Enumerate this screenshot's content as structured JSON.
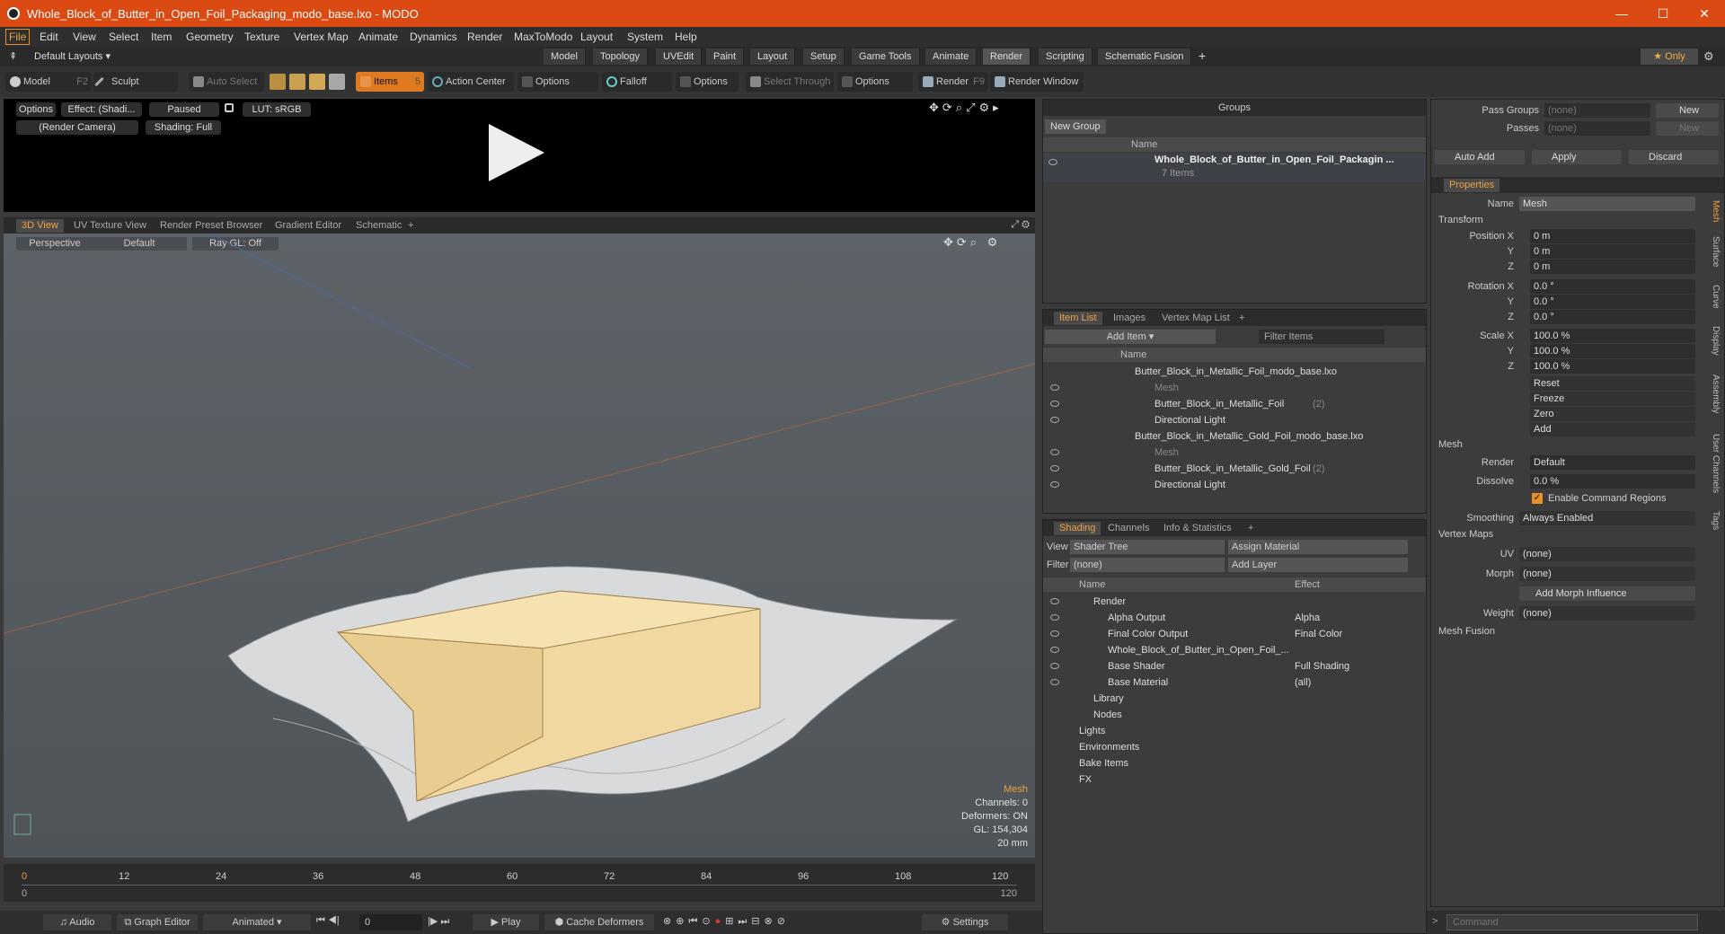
{
  "window": {
    "title": "Whole_Block_of_Butter_in_Open_Foil_Packaging_modo_base.lxo - MODO",
    "minimize": "—",
    "maximize": "☐",
    "close": "✕"
  },
  "menu": [
    "File",
    "Edit",
    "View",
    "Select",
    "Item",
    "Geometry",
    "Texture",
    "Vertex Map",
    "Animate",
    "Dynamics",
    "Render",
    "MaxToModo",
    "Layout",
    "System",
    "Help"
  ],
  "layouts": {
    "label": "Default Layouts ▾",
    "tabs": [
      "Model",
      "Topology",
      "UVEdit",
      "Paint",
      "Layout",
      "Setup",
      "Game Tools",
      "Animate",
      "Render",
      "Scripting",
      "Schematic Fusion"
    ],
    "active": "Render",
    "plus": "+",
    "only": "★  Only"
  },
  "toolbar": {
    "model": "Model",
    "model_key": "F2",
    "sculpt": "Sculpt",
    "auto_select": "Auto Select",
    "items": "Items",
    "items_key": "5",
    "action_center": "Action Center",
    "options1": "Options",
    "falloff": "Falloff",
    "options2": "Options",
    "select_through": "Select Through",
    "options3": "Options",
    "render": "Render",
    "render_key": "F9",
    "render_window": "Render Window"
  },
  "preview": {
    "options": "Options",
    "effect": "Effect: (Shadi...",
    "paused": "Paused",
    "lut": "LUT: sRGB",
    "camera": "(Render Camera)",
    "shading": "Shading: Full"
  },
  "viewport_tabs": [
    "3D View",
    "UV Texture View",
    "Render Preset Browser",
    "Gradient Editor",
    "Schematic",
    "+"
  ],
  "viewport": {
    "perspective": "Perspective",
    "default": "Default",
    "raygl": "Ray GL: Off",
    "stats": {
      "item": "Mesh",
      "channels": "Channels: 0",
      "deformers": "Deformers: ON",
      "gl": "GL: 154,304",
      "size": "20 mm"
    }
  },
  "timeline": {
    "ticks": [
      "0",
      "12",
      "24",
      "36",
      "48",
      "60",
      "72",
      "84",
      "96",
      "108",
      "120"
    ],
    "start": "0",
    "end": "120"
  },
  "bottombar": {
    "audio": "Audio",
    "graph_editor": "Graph Editor",
    "animated": "Animated",
    "frame": "0",
    "play": "Play",
    "cache": "Cache Deformers",
    "settings": "Settings",
    "command_placeholder": "Command"
  },
  "groups": {
    "title": "Groups",
    "new_group": "New Group",
    "col_name": "Name",
    "item": "Whole_Block_of_Butter_in_Open_Foil_Packagin ...",
    "count": "7 Items"
  },
  "item_list": {
    "tabs": [
      "Item List",
      "Images",
      "Vertex Map List",
      "+"
    ],
    "add_item": "Add Item",
    "filter": "Filter Items",
    "col_name": "Name",
    "rows": [
      {
        "label": "Butter_Block_in_Metallic_Foil_modo_base.lxo",
        "indent": 0,
        "dim": false,
        "eye": false
      },
      {
        "label": "Mesh",
        "indent": 1,
        "dim": true,
        "eye": true
      },
      {
        "label": "Butter_Block_in_Metallic_Foil",
        "suffix": "(2)",
        "indent": 1,
        "dim": false,
        "eye": true
      },
      {
        "label": "Directional Light",
        "indent": 1,
        "dim": false,
        "eye": true
      },
      {
        "label": "Butter_Block_in_Metallic_Gold_Foil_modo_base.lxo",
        "indent": 0,
        "dim": false,
        "eye": false
      },
      {
        "label": "Mesh",
        "indent": 1,
        "dim": true,
        "eye": true
      },
      {
        "label": "Butter_Block_in_Metallic_Gold_Foil",
        "suffix": "(2)",
        "indent": 1,
        "dim": false,
        "eye": true
      },
      {
        "label": "Directional Light",
        "indent": 1,
        "dim": false,
        "eye": true
      }
    ]
  },
  "shading": {
    "tabs": [
      "Shading",
      "Channels",
      "Info & Statistics",
      "+"
    ],
    "view_label": "View",
    "view": "Shader Tree",
    "assign": "Assign Material",
    "filter_label": "Filter",
    "filter": "(none)",
    "add_layer": "Add Layer",
    "col_name": "Name",
    "col_effect": "Effect",
    "rows": [
      {
        "name": "Render",
        "effect": "",
        "indent": 1
      },
      {
        "name": "Alpha Output",
        "effect": "Alpha",
        "indent": 2
      },
      {
        "name": "Final Color Output",
        "effect": "Final Color",
        "indent": 2
      },
      {
        "name": "Whole_Block_of_Butter_in_Open_Foil_...",
        "effect": "",
        "indent": 2
      },
      {
        "name": "Base Shader",
        "effect": "Full Shading",
        "indent": 2
      },
      {
        "name": "Base Material",
        "effect": "(all)",
        "indent": 2
      },
      {
        "name": "Library",
        "effect": "",
        "indent": 1
      },
      {
        "name": "Nodes",
        "effect": "",
        "indent": 1
      },
      {
        "name": "Lights",
        "effect": "",
        "indent": 0
      },
      {
        "name": "Environments",
        "effect": "",
        "indent": 0
      },
      {
        "name": "Bake Items",
        "effect": "",
        "indent": 0
      },
      {
        "name": "FX",
        "effect": "",
        "indent": 0
      }
    ]
  },
  "properties": {
    "pass_groups": "Pass Groups",
    "passes": "Passes",
    "none": "(none)",
    "new": "New",
    "auto_add": "Auto Add",
    "apply": "Apply",
    "discard": "Discard",
    "tab": "Properties",
    "name_label": "Name",
    "name": "Mesh",
    "transform": "Transform",
    "pos_label": "Position X",
    "rot_label": "Rotation X",
    "scale_label": "Scale X",
    "y": "Y",
    "z": "Z",
    "pos": [
      "0 m",
      "0 m",
      "0 m"
    ],
    "rot": [
      "0.0 °",
      "0.0 °",
      "0.0 °"
    ],
    "scale": [
      "100.0 %",
      "100.0 %",
      "100.0 %"
    ],
    "actions": [
      "Reset",
      "Freeze",
      "Zero",
      "Add"
    ],
    "mesh": "Mesh",
    "render_label": "Render",
    "render": "Default",
    "dissolve_label": "Dissolve",
    "dissolve": "0.0 %",
    "ecr": "Enable Command Regions",
    "smoothing_label": "Smoothing",
    "smoothing": "Always Enabled",
    "vmaps": "Vertex Maps",
    "uv_label": "UV",
    "morph_label": "Morph",
    "weight_label": "Weight",
    "add_morph": "Add Morph Influence",
    "mesh_fusion": "Mesh Fusion",
    "side_tabs": [
      "Mesh",
      "Surface",
      "Curve",
      "Display",
      "Assembly",
      "User Channels",
      "Tags"
    ]
  },
  "colors": {
    "title_bar": "#dc4a14",
    "accent": "#e8902a",
    "butter": "#f0d8a0"
  }
}
